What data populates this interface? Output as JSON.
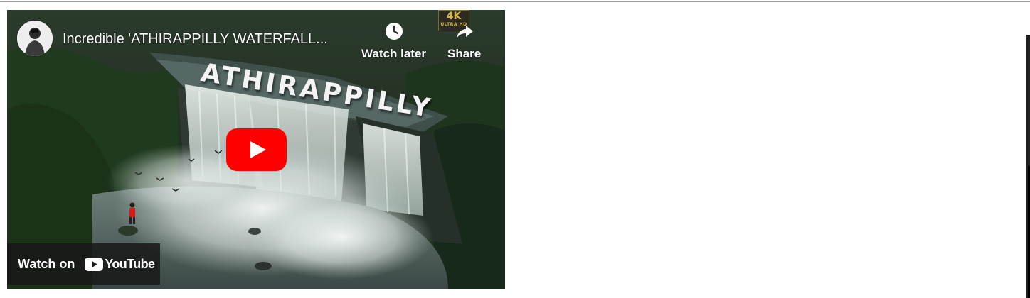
{
  "embed": {
    "title": "Incredible 'ATHIRAPPILLY WATERFALL...",
    "watch_later_label": "Watch later",
    "share_label": "Share",
    "watch_on_label": "Watch on",
    "youtube_wordmark": "YouTube",
    "overlay_text": "ATHIRAPPILLY",
    "badge": {
      "main": "4K",
      "sub": "ULTRA HD"
    },
    "icons": {
      "avatar": "channel-avatar",
      "watch_later": "clock-icon",
      "share": "share-arrow-icon",
      "play": "youtube-play-icon"
    },
    "colors": {
      "play_red": "#ff0000",
      "overlay_bar": "#171717",
      "text": "#ffffff"
    }
  }
}
